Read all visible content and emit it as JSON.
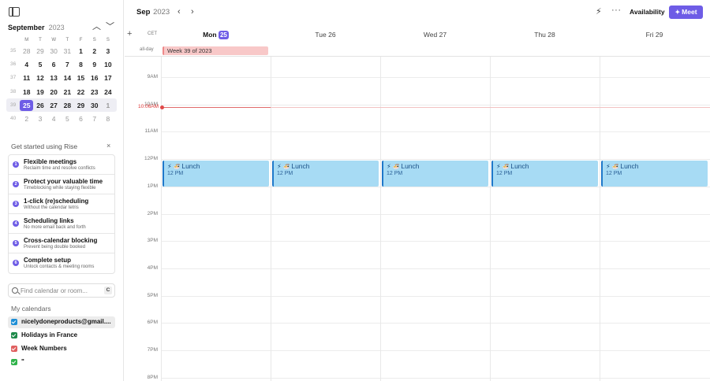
{
  "sidebar": {
    "mini_cal": {
      "month": "September",
      "year": "2023",
      "prev_icon": "chevron-up-icon",
      "next_icon": "chevron-down-icon",
      "dows": [
        "M",
        "T",
        "W",
        "T",
        "F",
        "S",
        "S"
      ],
      "weeks": [
        {
          "wk": "35",
          "days": [
            "28",
            "29",
            "30",
            "31",
            "1",
            "2",
            "3"
          ]
        },
        {
          "wk": "36",
          "days": [
            "4",
            "5",
            "6",
            "7",
            "8",
            "9",
            "10"
          ]
        },
        {
          "wk": "37",
          "days": [
            "11",
            "12",
            "13",
            "14",
            "15",
            "16",
            "17"
          ]
        },
        {
          "wk": "38",
          "days": [
            "18",
            "19",
            "20",
            "21",
            "22",
            "23",
            "24"
          ]
        },
        {
          "wk": "39",
          "days": [
            "25",
            "26",
            "27",
            "28",
            "29",
            "30",
            "1"
          ]
        },
        {
          "wk": "40",
          "days": [
            "2",
            "3",
            "4",
            "5",
            "6",
            "7",
            "8"
          ]
        }
      ]
    },
    "getting_started": {
      "title": "Get started using Rise",
      "close": "×",
      "items": [
        {
          "num": "1",
          "title": "Flexible meetings",
          "sub": "Reclaim time and resolve conflicts"
        },
        {
          "num": "2",
          "title": "Protect your valuable time",
          "sub": "Timeblocking while staying flexible"
        },
        {
          "num": "3",
          "title": "1-click (re)scheduling",
          "sub": "Without the calendar tetris"
        },
        {
          "num": "4",
          "title": "Scheduling links",
          "sub": "No more email back and forth"
        },
        {
          "num": "5",
          "title": "Cross-calendar blocking",
          "sub": "Prevent being double booked"
        },
        {
          "num": "6",
          "title": "Complete setup",
          "sub": "Unlock contacts & meeting rooms"
        }
      ]
    },
    "search": {
      "placeholder": "Find calendar or room...",
      "shortcut": "C"
    },
    "my_calendars": {
      "title": "My calendars",
      "items": [
        {
          "label": "nicelydoneproducts@gmail....",
          "color": "#1f8fd6"
        },
        {
          "label": "Holidays in France",
          "color": "#1e8a4a"
        },
        {
          "label": "Week Numbers",
          "color": "#e06060"
        },
        {
          "label": "\"",
          "color": "#2fb34a"
        }
      ]
    }
  },
  "topbar": {
    "month": "Sep",
    "year": "2023",
    "prev": "‹",
    "next": "›",
    "bolt_icon": "bolt-icon",
    "more": "···",
    "availability": "Availability",
    "meet": "Meet"
  },
  "calendar": {
    "timezone": "CET",
    "add": "+",
    "allday_label": "all-day",
    "days": [
      {
        "dow": "Mon",
        "num": "25"
      },
      {
        "dow": "Tue",
        "num": "26"
      },
      {
        "dow": "Wed",
        "num": "27"
      },
      {
        "dow": "Thu",
        "num": "28"
      },
      {
        "dow": "Fri",
        "num": "29"
      }
    ],
    "allday_event": "Week 39 of 2023",
    "hours": [
      "9AM",
      "10AM",
      "11AM",
      "12PM",
      "1PM",
      "2PM",
      "3PM",
      "4PM",
      "5PM",
      "6PM",
      "7PM",
      "8PM"
    ],
    "now_label": "10:06AM",
    "events": [
      {
        "title": "Lunch",
        "time": "12 PM",
        "emoji": "🍜"
      },
      {
        "title": "Lunch",
        "time": "12 PM",
        "emoji": "🍜"
      },
      {
        "title": "Lunch",
        "time": "12 PM",
        "emoji": "🍜"
      },
      {
        "title": "Lunch",
        "time": "12 PM",
        "emoji": "🍜"
      },
      {
        "title": "Lunch",
        "time": "12 PM",
        "emoji": "🍜"
      }
    ]
  }
}
